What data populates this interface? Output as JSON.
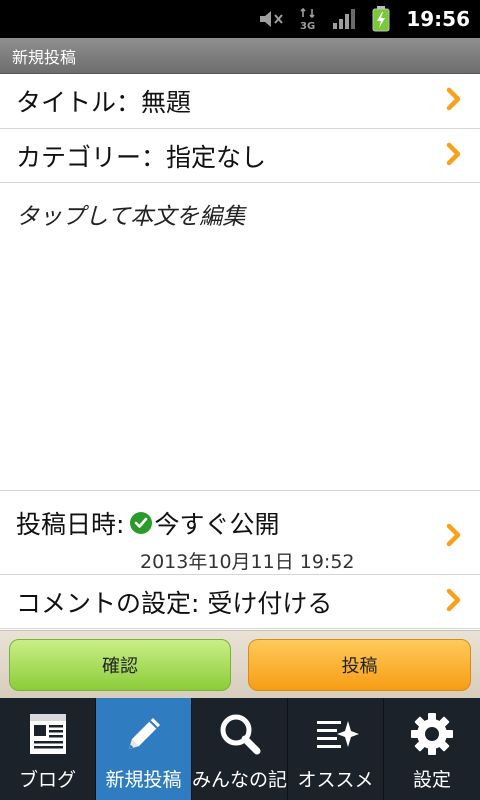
{
  "status_bar": {
    "time": "19:56",
    "icons": [
      "mute-icon",
      "3g-icon",
      "signal-icon",
      "battery-charging-icon"
    ]
  },
  "header": {
    "title": "新規投稿"
  },
  "form": {
    "title_row": "タイトル：無題",
    "category_row": "カテゴリー：指定なし",
    "body_placeholder": "タップして本文を編集",
    "post_date_label": "投稿日時:",
    "post_date_status": "今すぐ公開",
    "post_date_value": "2013年10月11日 19:52",
    "comment_row": "コメントの設定: 受け付ける"
  },
  "actions": {
    "confirm_label": "確認",
    "post_label": "投稿"
  },
  "nav": {
    "items": [
      {
        "label": "ブログ",
        "icon": "blog-icon"
      },
      {
        "label": "新規投稿",
        "icon": "pencil-icon",
        "active": true
      },
      {
        "label": "みんなの記事",
        "icon": "search-icon"
      },
      {
        "label": "オススメ",
        "icon": "sparkle-list-icon"
      },
      {
        "label": "設定",
        "icon": "gear-icon"
      }
    ]
  },
  "colors": {
    "accent_orange": "#f7a21a",
    "nav_active": "#2f7dc0",
    "confirm_green": "#8ccc3a"
  }
}
